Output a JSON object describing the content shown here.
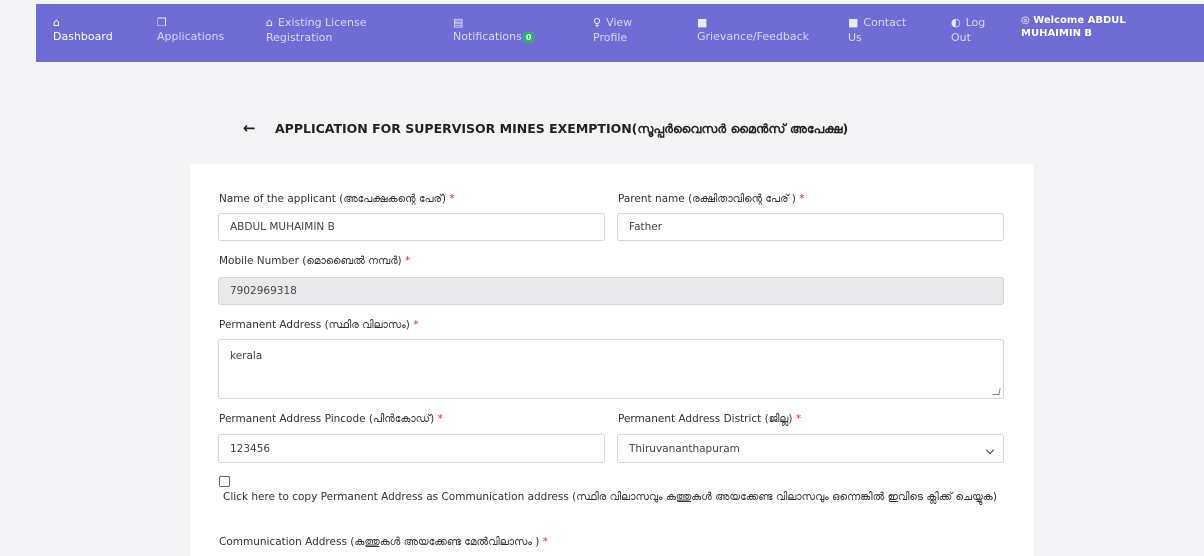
{
  "nav": {
    "items": [
      {
        "icon": "home-icon",
        "glyph": "⌂",
        "label_line1": "",
        "label_line2": "Dashboard"
      },
      {
        "icon": "applications-icon",
        "glyph": "❐",
        "label_line1": "",
        "label_line2": "Applications"
      },
      {
        "icon": "license-icon",
        "glyph": "⌂",
        "label_line1": "Existing License",
        "label_line2": "Registration"
      },
      {
        "icon": "notifications-icon",
        "glyph": "▤",
        "label_line1": "",
        "label_line2": "Notifications",
        "badge": "0"
      },
      {
        "icon": "user-icon",
        "glyph": "♀",
        "label_line1": "View",
        "label_line2": "Profile"
      },
      {
        "icon": "feedback-icon",
        "glyph": "■",
        "label_line1": "",
        "label_line2": "Grievance/Feedback"
      },
      {
        "icon": "contact-icon",
        "glyph": "■",
        "label_line1": "Contact",
        "label_line2": "Us"
      },
      {
        "icon": "logout-icon",
        "glyph": "◐",
        "label_line1": "Log",
        "label_line2": "Out"
      }
    ],
    "welcome_icon": "◎",
    "welcome_line1": "Welcome ABDUL",
    "welcome_line2": "MUHAIMIN B"
  },
  "header": {
    "back_glyph": "←",
    "title": "APPLICATION FOR SUPERVISOR MINES EXEMPTION(സൂപ്പർവൈസർ മൈൻസ് അപേക്ഷ)"
  },
  "form": {
    "applicant_name": {
      "label": "Name of the applicant (അപേക്ഷകന്റെ പേര്)",
      "value": "ABDUL MUHAIMIN B"
    },
    "parent_name": {
      "label": "Parent name (രക്ഷിതാവിന്റെ പേര് )",
      "value": "Father"
    },
    "mobile": {
      "label": "Mobile Number (മൊബൈൽ നമ്പർ)",
      "value": "7902969318"
    },
    "permanent_address": {
      "label": "Permanent Address (സ്ഥിര വിലാസം)",
      "value": "kerala"
    },
    "pincode": {
      "label": "Permanent Address Pincode (പിൻകോഡ്)",
      "value": "123456"
    },
    "district": {
      "label": "Permanent Address District (ജില്ല)",
      "value": "Thiruvananthapuram"
    },
    "copy_address_text": "Click here to copy Permanent Address as Communication address (സ്ഥിര വിലാസവും കത്തുകൾ അയക്കേണ്ട വിലാസവും ഒന്നെങ്കിൽ ഇവിടെ ക്ലിക്ക് ചെയ്യുക)",
    "communication_address": {
      "label": "Communication Address (കത്തുകൾ അയക്കേണ്ട മേൽവിലാസം )"
    },
    "required_mark": "*"
  },
  "colors": {
    "navbar": "#6f6cd6",
    "badge": "#2bb36b",
    "required": "#e0272a"
  }
}
